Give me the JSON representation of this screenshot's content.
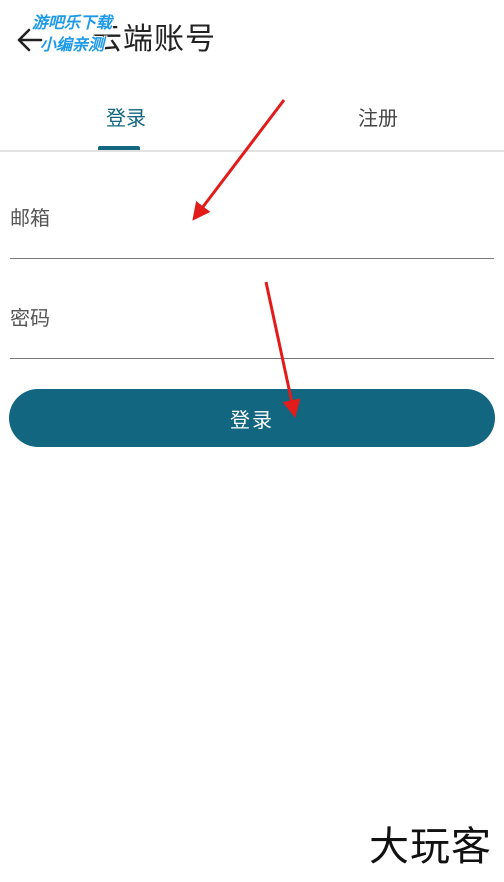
{
  "header": {
    "back_icon": "arrow-left-icon",
    "title": "云端账号"
  },
  "watermark_top": {
    "line1": "游吧乐下载",
    "line2": "小编亲测"
  },
  "tabs": [
    {
      "label": "登录",
      "active": true
    },
    {
      "label": "注册",
      "active": false
    }
  ],
  "form": {
    "email_placeholder": "邮箱",
    "email_value": "",
    "password_placeholder": "密码",
    "password_value": "",
    "submit_label": "登录"
  },
  "annotations": {
    "arrow_icon": "red-arrow-icon",
    "color": "#e21b1b"
  },
  "watermark_bottom": "大玩客",
  "colors": {
    "accent": "#12667f",
    "background": "#ffffff",
    "divider": "#e2e2e2"
  }
}
